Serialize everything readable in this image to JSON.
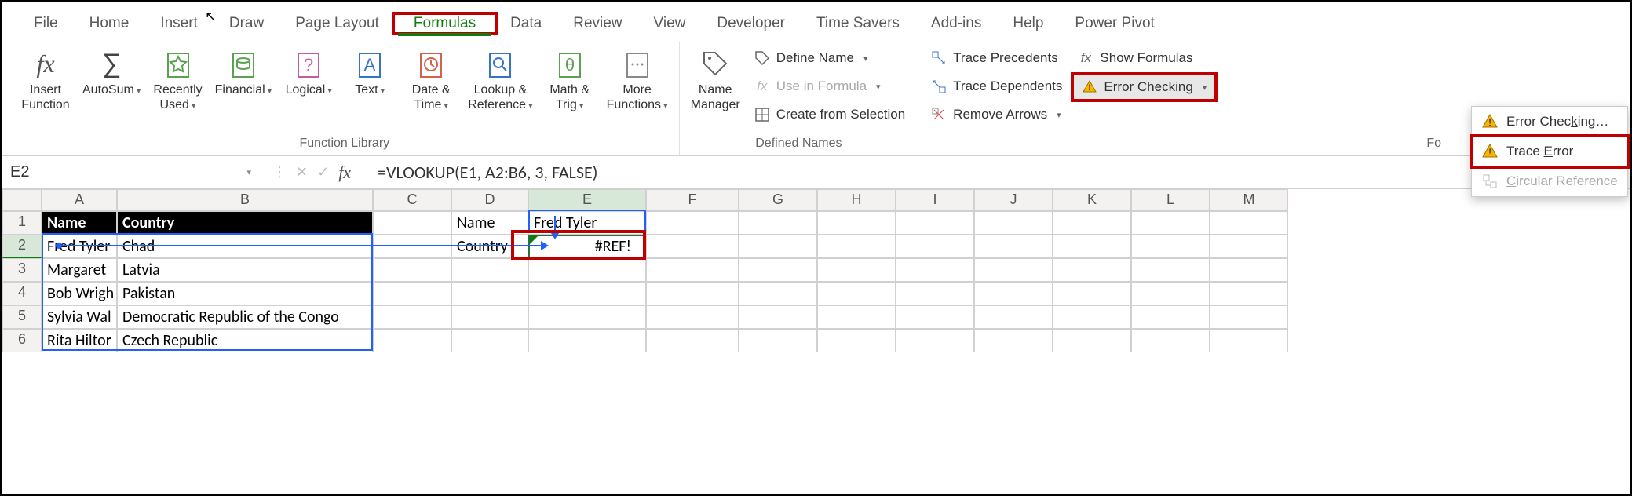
{
  "tabs": [
    "File",
    "Home",
    "Insert",
    "Draw",
    "Page Layout",
    "Formulas",
    "Data",
    "Review",
    "View",
    "Developer",
    "Time Savers",
    "Add-ins",
    "Help",
    "Power Pivot"
  ],
  "active_tab": "Formulas",
  "ribbon": {
    "function_library": {
      "label": "Function Library",
      "insert_function": "Insert\nFunction",
      "autosum": "AutoSum",
      "recently_used": "Recently\nUsed",
      "financial": "Financial",
      "logical": "Logical",
      "text": "Text",
      "date_time": "Date &\nTime",
      "lookup_reference": "Lookup &\nReference",
      "math_trig": "Math &\nTrig",
      "more_functions": "More\nFunctions"
    },
    "defined_names": {
      "label": "Defined Names",
      "name_manager": "Name\nManager",
      "define_name": "Define Name",
      "use_in_formula": "Use in Formula",
      "create_from_selection": "Create from Selection"
    },
    "formula_auditing": {
      "label_short": "Fo",
      "trace_precedents": "Trace Precedents",
      "trace_dependents": "Trace Dependents",
      "remove_arrows": "Remove Arrows",
      "show_formulas": "Show Formulas",
      "error_checking": "Error Checking"
    }
  },
  "dropdown": {
    "error_checking": "Error Checking…",
    "trace_error": "Trace Error",
    "circular_references": "Circular References"
  },
  "namebox": "E2",
  "formula": "=VLOOKUP(E1, A2:B6, 3, FALSE)",
  "columns": [
    "A",
    "B",
    "C",
    "D",
    "E",
    "F",
    "G",
    "H",
    "I",
    "J",
    "K",
    "L",
    "M"
  ],
  "rows": [
    "1",
    "2",
    "3",
    "4",
    "5",
    "6"
  ],
  "grid": {
    "A1": "Name",
    "B1": "Country",
    "A2": "Fred Tyler",
    "B2": "Chad",
    "A3": "Margaret",
    "B3": "Latvia",
    "A4": "Bob Wrigh",
    "B4": "Pakistan",
    "A5": "Sylvia Wal",
    "B5": "Democratic Republic of the Congo",
    "A6": "Rita Hiltor",
    "B6": "Czech Republic",
    "D1": "Name",
    "E1": "Fred Tyler",
    "D2": "Country",
    "E2": "#REF!"
  },
  "colors": {
    "accent": "#0f7b0f",
    "highlight_box": "#c00000",
    "trace_arrow": "#2060ff"
  }
}
